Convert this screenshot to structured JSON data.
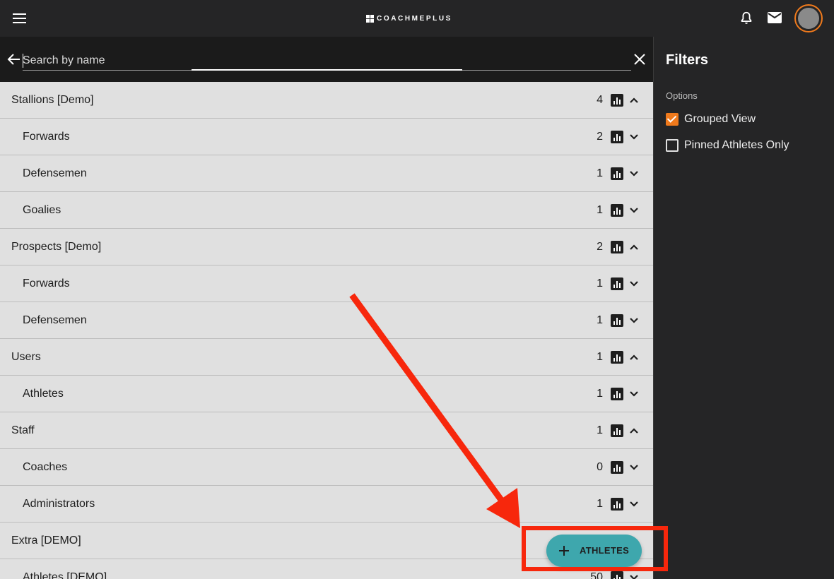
{
  "header": {
    "brand": "COACHMEPLUS"
  },
  "search": {
    "placeholder": "Search by name",
    "value": ""
  },
  "groups": [
    {
      "label": "Stallions [Demo]",
      "count": "4",
      "level": "group",
      "expanded": true
    },
    {
      "label": "Forwards",
      "count": "2",
      "level": "sub",
      "expanded": false
    },
    {
      "label": "Defensemen",
      "count": "1",
      "level": "sub",
      "expanded": false
    },
    {
      "label": "Goalies",
      "count": "1",
      "level": "sub",
      "expanded": false
    },
    {
      "label": "Prospects [Demo]",
      "count": "2",
      "level": "group",
      "expanded": true
    },
    {
      "label": "Forwards",
      "count": "1",
      "level": "sub",
      "expanded": false
    },
    {
      "label": "Defensemen",
      "count": "1",
      "level": "sub",
      "expanded": false
    },
    {
      "label": "Users",
      "count": "1",
      "level": "group",
      "expanded": true
    },
    {
      "label": "Athletes",
      "count": "1",
      "level": "sub",
      "expanded": false
    },
    {
      "label": "Staff",
      "count": "1",
      "level": "group",
      "expanded": true
    },
    {
      "label": "Coaches",
      "count": "0",
      "level": "sub",
      "expanded": false
    },
    {
      "label": "Administrators",
      "count": "1",
      "level": "sub",
      "expanded": false
    },
    {
      "label": "Extra [DEMO]",
      "count": "",
      "level": "group",
      "expanded": true
    },
    {
      "label": "Athletes [DEMO]",
      "count": "50",
      "level": "sub",
      "expanded": false
    }
  ],
  "fab": {
    "label": "ATHLETES"
  },
  "filters": {
    "title": "Filters",
    "options_label": "Options",
    "options": [
      {
        "label": "Grouped View",
        "checked": true
      },
      {
        "label": "Pinned Athletes Only",
        "checked": false
      }
    ]
  },
  "colors": {
    "accent": "#f07a1c",
    "fab": "#3ea7ad",
    "annotation": "#f7270c"
  },
  "icons": {
    "menu": "menu-icon",
    "bell": "bell-icon",
    "mail": "mail-icon",
    "back": "arrow-left-icon",
    "clear": "close-icon",
    "chart": "bar-chart-icon",
    "expand": "chevron-down-icon",
    "collapse": "chevron-up-icon",
    "add": "plus-icon"
  }
}
